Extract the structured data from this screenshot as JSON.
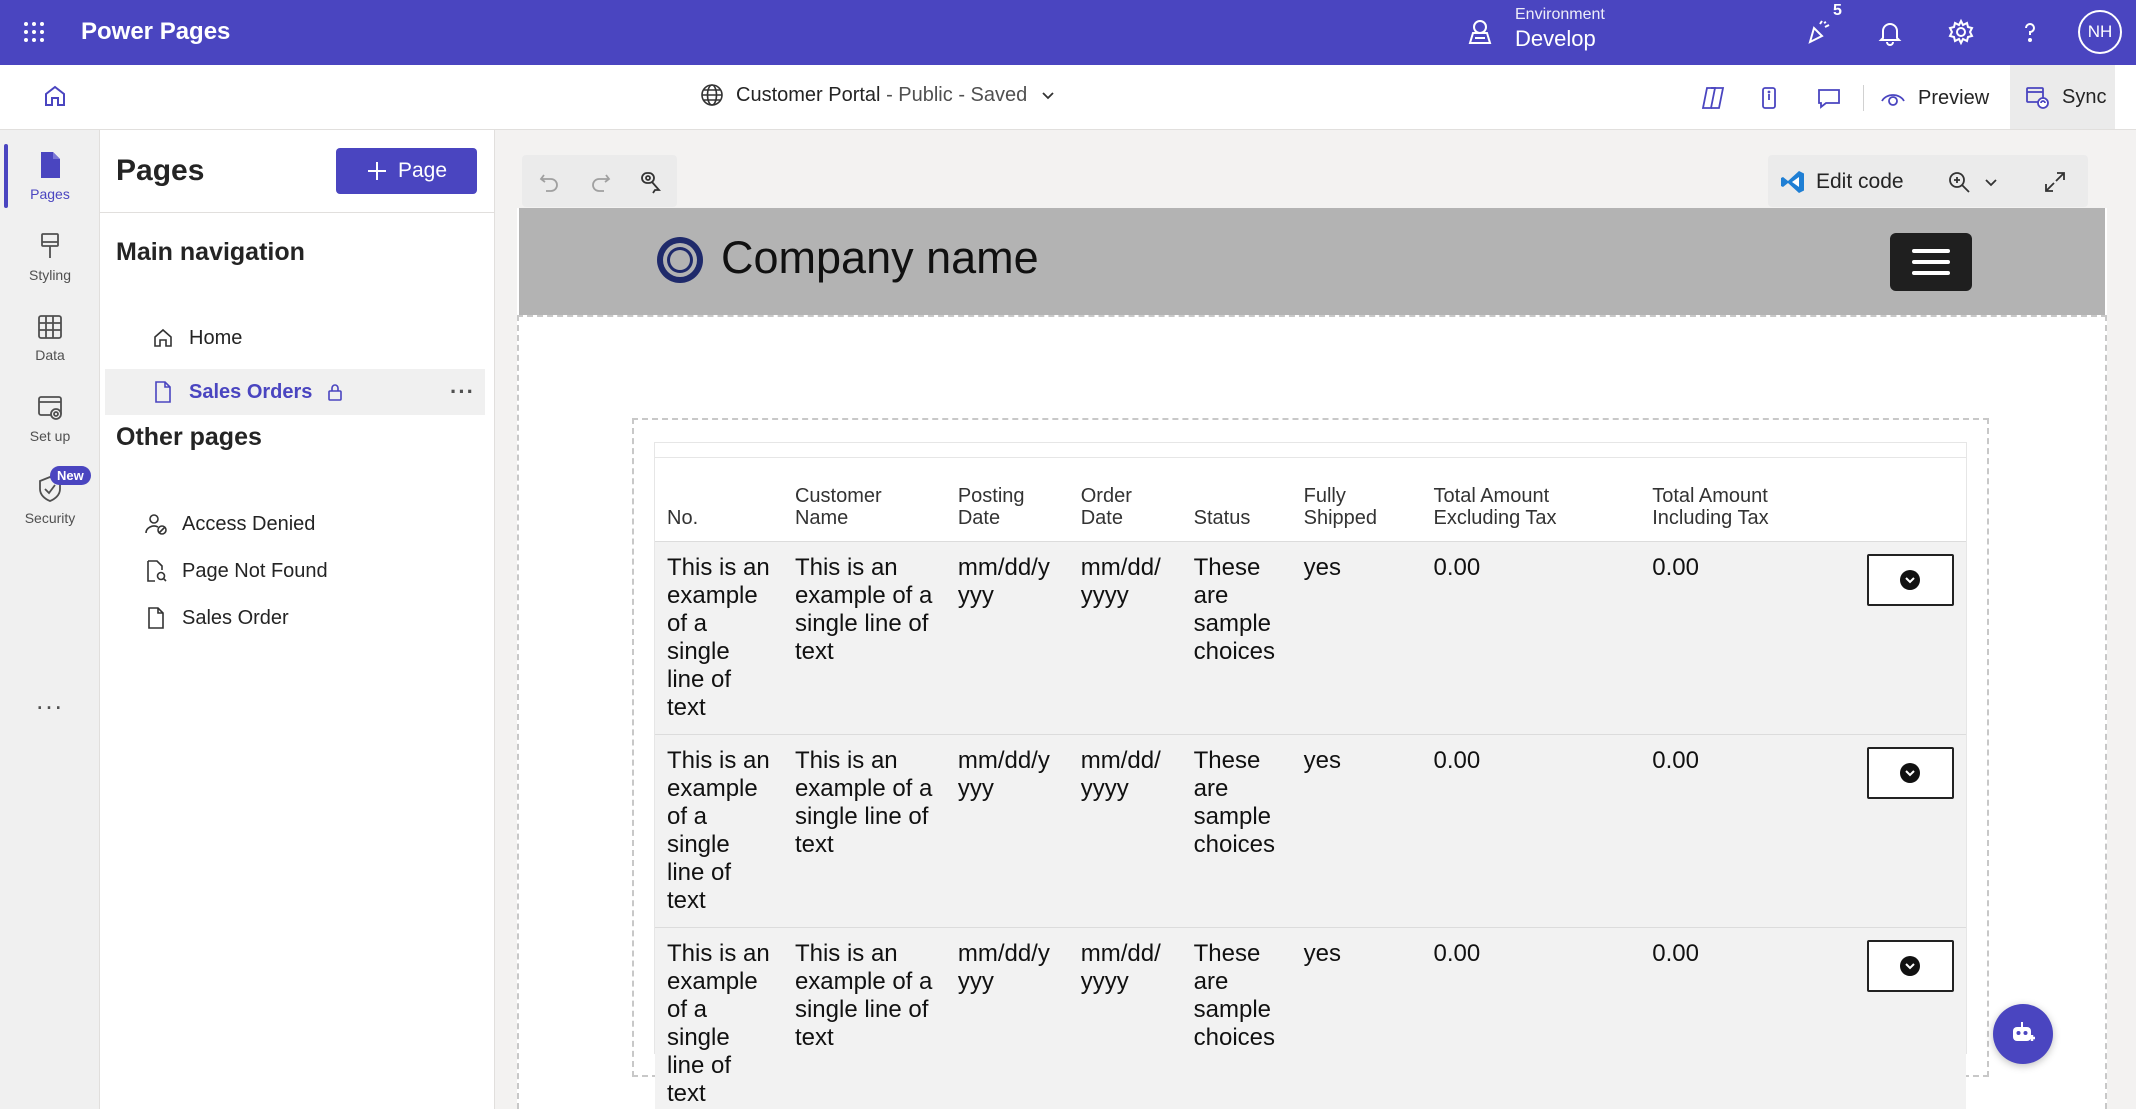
{
  "header": {
    "app_title": "Power Pages",
    "environment_label": "Environment",
    "environment_value": "Develop",
    "notification_count": "5",
    "avatar_initials": "NH"
  },
  "commandbar": {
    "site_name": "Customer Portal",
    "site_visibility": "- Public",
    "site_status": "- Saved",
    "preview_label": "Preview",
    "sync_label": "Sync"
  },
  "rail": {
    "items": [
      {
        "label": "Pages"
      },
      {
        "label": "Styling"
      },
      {
        "label": "Data"
      },
      {
        "label": "Set up"
      },
      {
        "label": "Security"
      }
    ],
    "new_badge": "New",
    "more_label": "..."
  },
  "pages_panel": {
    "title": "Pages",
    "add_button": "Page",
    "main_nav_title": "Main navigation",
    "main_nav": [
      {
        "label": "Home"
      },
      {
        "label": "Sales Orders"
      }
    ],
    "other_title": "Other pages",
    "other_pages": [
      {
        "label": "Access Denied"
      },
      {
        "label": "Page Not Found"
      },
      {
        "label": "Sales Order"
      }
    ]
  },
  "canvas": {
    "edit_code_label": "Edit code"
  },
  "site": {
    "company_name": "Company name"
  },
  "table": {
    "columns": [
      "No.",
      "Customer Name",
      "Posting Date",
      "Order Date",
      "Status",
      "Fully Shipped",
      "Total Amount Excluding Tax",
      "Total Amount Including Tax"
    ],
    "rows": [
      [
        "This is an example of a single line of text",
        "This is an example of a single line of text",
        "mm/dd/yyyy",
        "mm/dd/yyyy",
        "These are sample choices",
        "yes",
        "0.00",
        "0.00"
      ],
      [
        "This is an example of a single line of text",
        "This is an example of a single line of text",
        "mm/dd/yyyy",
        "mm/dd/yyyy",
        "These are sample choices",
        "yes",
        "0.00",
        "0.00"
      ],
      [
        "This is an example of a single line of text",
        "This is an example of a single line of text",
        "mm/dd/yyyy",
        "mm/dd/yyyy",
        "These are sample choices",
        "yes",
        "0.00",
        "0.00"
      ]
    ]
  },
  "colors": {
    "brand": "#4a45c0",
    "site_header": "#b3b3b3"
  }
}
